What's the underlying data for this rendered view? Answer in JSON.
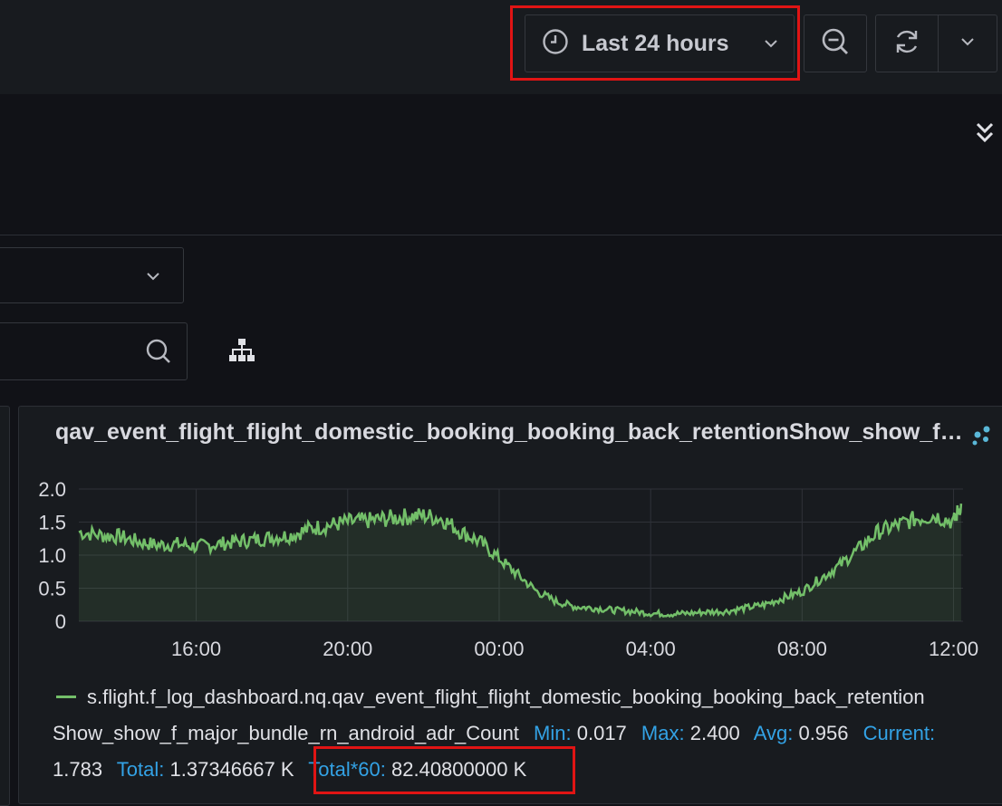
{
  "toolbar": {
    "time_range_label": "Last 24 hours",
    "icons": [
      "clock-icon",
      "chevron-down-icon",
      "zoom-out-icon",
      "refresh-icon",
      "chevron-down-icon"
    ]
  },
  "panel": {
    "title": "qav_event_flight_flight_domestic_booking_booking_back_retentionShow_show_f_major_bundle_rn_android_adr_Count"
  },
  "chart_data": {
    "type": "area",
    "y_ticks": [
      "2.0",
      "1.5",
      "1.0",
      "0.5",
      "0"
    ],
    "x_ticks": [
      "16:00",
      "20:00",
      "00:00",
      "04:00",
      "08:00",
      "12:00"
    ],
    "ylim": [
      0,
      2.0
    ],
    "xlim_hours": [
      12.9,
      36.25
    ],
    "grid": true,
    "series": [
      {
        "name": "s.flight.f_log_dashboard.nq.qav_event_flight_flight_domestic_booking_booking_back_retentionShow_show_f_major_bundle_rn_android_adr_Count",
        "color": "#73bf69",
        "x_hours": [
          12.9,
          13.5,
          14.0,
          14.5,
          15.0,
          15.5,
          16.0,
          16.5,
          17.0,
          17.5,
          18.0,
          18.5,
          19.0,
          19.5,
          20.0,
          20.5,
          21.0,
          21.5,
          22.0,
          22.5,
          23.0,
          23.5,
          24.0,
          24.5,
          25.0,
          25.5,
          26.0,
          26.5,
          27.0,
          27.5,
          28.0,
          28.5,
          29.0,
          29.5,
          30.0,
          30.5,
          31.0,
          31.5,
          32.0,
          32.5,
          33.0,
          33.5,
          34.0,
          34.5,
          35.0,
          35.5,
          36.0,
          36.2
        ],
        "values": [
          1.35,
          1.3,
          1.28,
          1.2,
          1.15,
          1.17,
          1.13,
          1.16,
          1.2,
          1.23,
          1.27,
          1.3,
          1.4,
          1.45,
          1.5,
          1.52,
          1.55,
          1.58,
          1.6,
          1.55,
          1.35,
          1.2,
          0.95,
          0.7,
          0.45,
          0.3,
          0.22,
          0.2,
          0.17,
          0.15,
          0.12,
          0.11,
          0.12,
          0.14,
          0.15,
          0.2,
          0.25,
          0.35,
          0.45,
          0.65,
          0.85,
          1.1,
          1.35,
          1.45,
          1.55,
          1.6,
          1.5,
          1.78
        ]
      }
    ]
  },
  "legend": {
    "series_label": "s.flight.f_log_dashboard.nq.qav_event_flight_flight_domestic_booking_booking_back_retention",
    "series_label_cont": "Show_show_f_major_bundle_rn_android_adr_Count",
    "min_label": "Min:",
    "min_value": "0.017",
    "max_label": "Max:",
    "max_value": "2.400",
    "avg_label": "Avg:",
    "avg_value": "0.956",
    "current_label": "Current:",
    "current_value": "1.783",
    "total_label": "Total:",
    "total_value": "1.37346667 K",
    "total60_label": "Total*60:",
    "total60_value": "82.40800000 K"
  }
}
